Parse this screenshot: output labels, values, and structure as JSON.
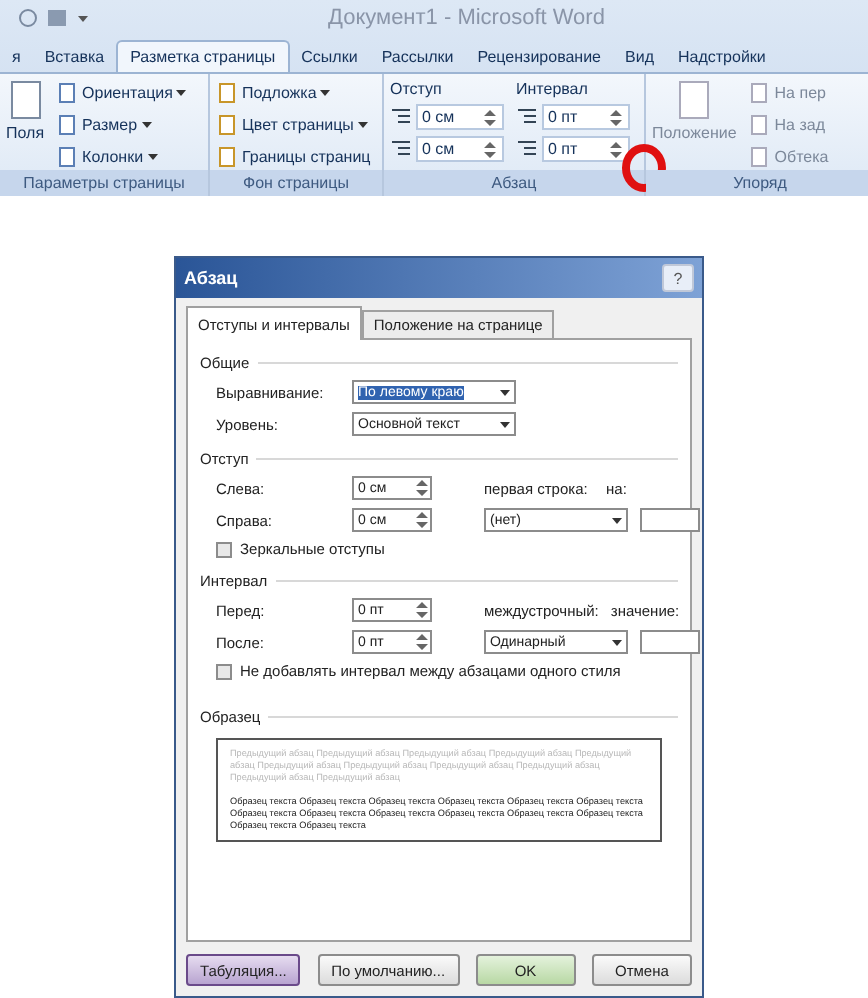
{
  "title_bar": {
    "title": "Документ1 - Microsoft Word"
  },
  "ribbon_tabs": [
    {
      "label": "я",
      "selected": false
    },
    {
      "label": "Вставка",
      "selected": false
    },
    {
      "label": "Разметка страницы",
      "selected": true
    },
    {
      "label": "Ссылки",
      "selected": false
    },
    {
      "label": "Рассылки",
      "selected": false
    },
    {
      "label": "Рецензирование",
      "selected": false
    },
    {
      "label": "Вид",
      "selected": false
    },
    {
      "label": "Надстройки",
      "selected": false
    }
  ],
  "page_setup": {
    "big_button": "Поля",
    "items": [
      {
        "label": "Ориентация",
        "dropdown": true
      },
      {
        "label": "Размер",
        "dropdown": true
      },
      {
        "label": "Колонки",
        "dropdown": true
      }
    ],
    "label": "Параметры страницы"
  },
  "page_background": {
    "items": [
      {
        "label": "Подложка",
        "dropdown": true
      },
      {
        "label": "Цвет страницы",
        "dropdown": true
      },
      {
        "label": "Границы страниц",
        "dropdown": false
      }
    ],
    "label": "Фон страницы"
  },
  "paragraph": {
    "label": "Абзац",
    "indent": {
      "heading": "Отступ",
      "values": [
        "0 см",
        "0 см"
      ]
    },
    "spacing": {
      "heading": "Интервал",
      "values": [
        "0 пт",
        "0 пт"
      ]
    }
  },
  "arrange": {
    "big_button": "Положение",
    "items": [
      "На пер",
      "На зад",
      "Обтека"
    ],
    "label": "Упоряд"
  },
  "dialog": {
    "title": "Абзац",
    "help": "?",
    "tabs": [
      {
        "label": "Отступы и интервалы",
        "selected": true
      },
      {
        "label": "Положение на странице",
        "selected": false
      }
    ],
    "general": {
      "heading": "Общие",
      "fields": [
        {
          "label": "Выравнивание:",
          "value": "По левому краю",
          "highlighted": true
        },
        {
          "label": "Уровень:",
          "value": "Основной текст",
          "highlighted": false
        }
      ]
    },
    "indent": {
      "heading": "Отступ",
      "left": {
        "label": "Слева:",
        "value": "0 см"
      },
      "right": {
        "label": "Справа:",
        "value": "0 см"
      },
      "special": {
        "label": "первая строка:",
        "value": "(нет)"
      },
      "by": {
        "label": "на:"
      },
      "mirror": {
        "label": "Зеркальные отступы",
        "checked": false
      }
    },
    "spacing": {
      "heading": "Интервал",
      "before": {
        "label": "Перед:",
        "value": "0 пт"
      },
      "after": {
        "label": "После:",
        "value": "0 пт"
      },
      "line": {
        "label": "междустрочный:",
        "value": "Одинарный"
      },
      "at": {
        "label": "значение:"
      },
      "no_add": {
        "label": "Не добавлять интервал между абзацами одного стиля",
        "checked": false
      }
    },
    "preview": {
      "heading": "Образец",
      "previous": "Предыдущий абзац Предыдущий абзац Предыдущий абзац Предыдущий абзац Предыдущий абзац Предыдущий абзац Предыдущий абзац Предыдущий абзац Предыдущий абзац Предыдущий абзац Предыдущий абзац",
      "sample": "Образец текста Образец текста Образец текста Образец текста Образец текста Образец текста Образец текста Образец текста Образец текста Образец текста Образец текста Образец текста Образец текста Образец текста"
    },
    "buttons": [
      {
        "label": "Табуляция...",
        "kind": "focused"
      },
      {
        "label": "По умолчанию...",
        "kind": "normal"
      },
      {
        "label": "OK",
        "kind": "default"
      },
      {
        "label": "Отмена",
        "kind": "normal"
      }
    ]
  }
}
